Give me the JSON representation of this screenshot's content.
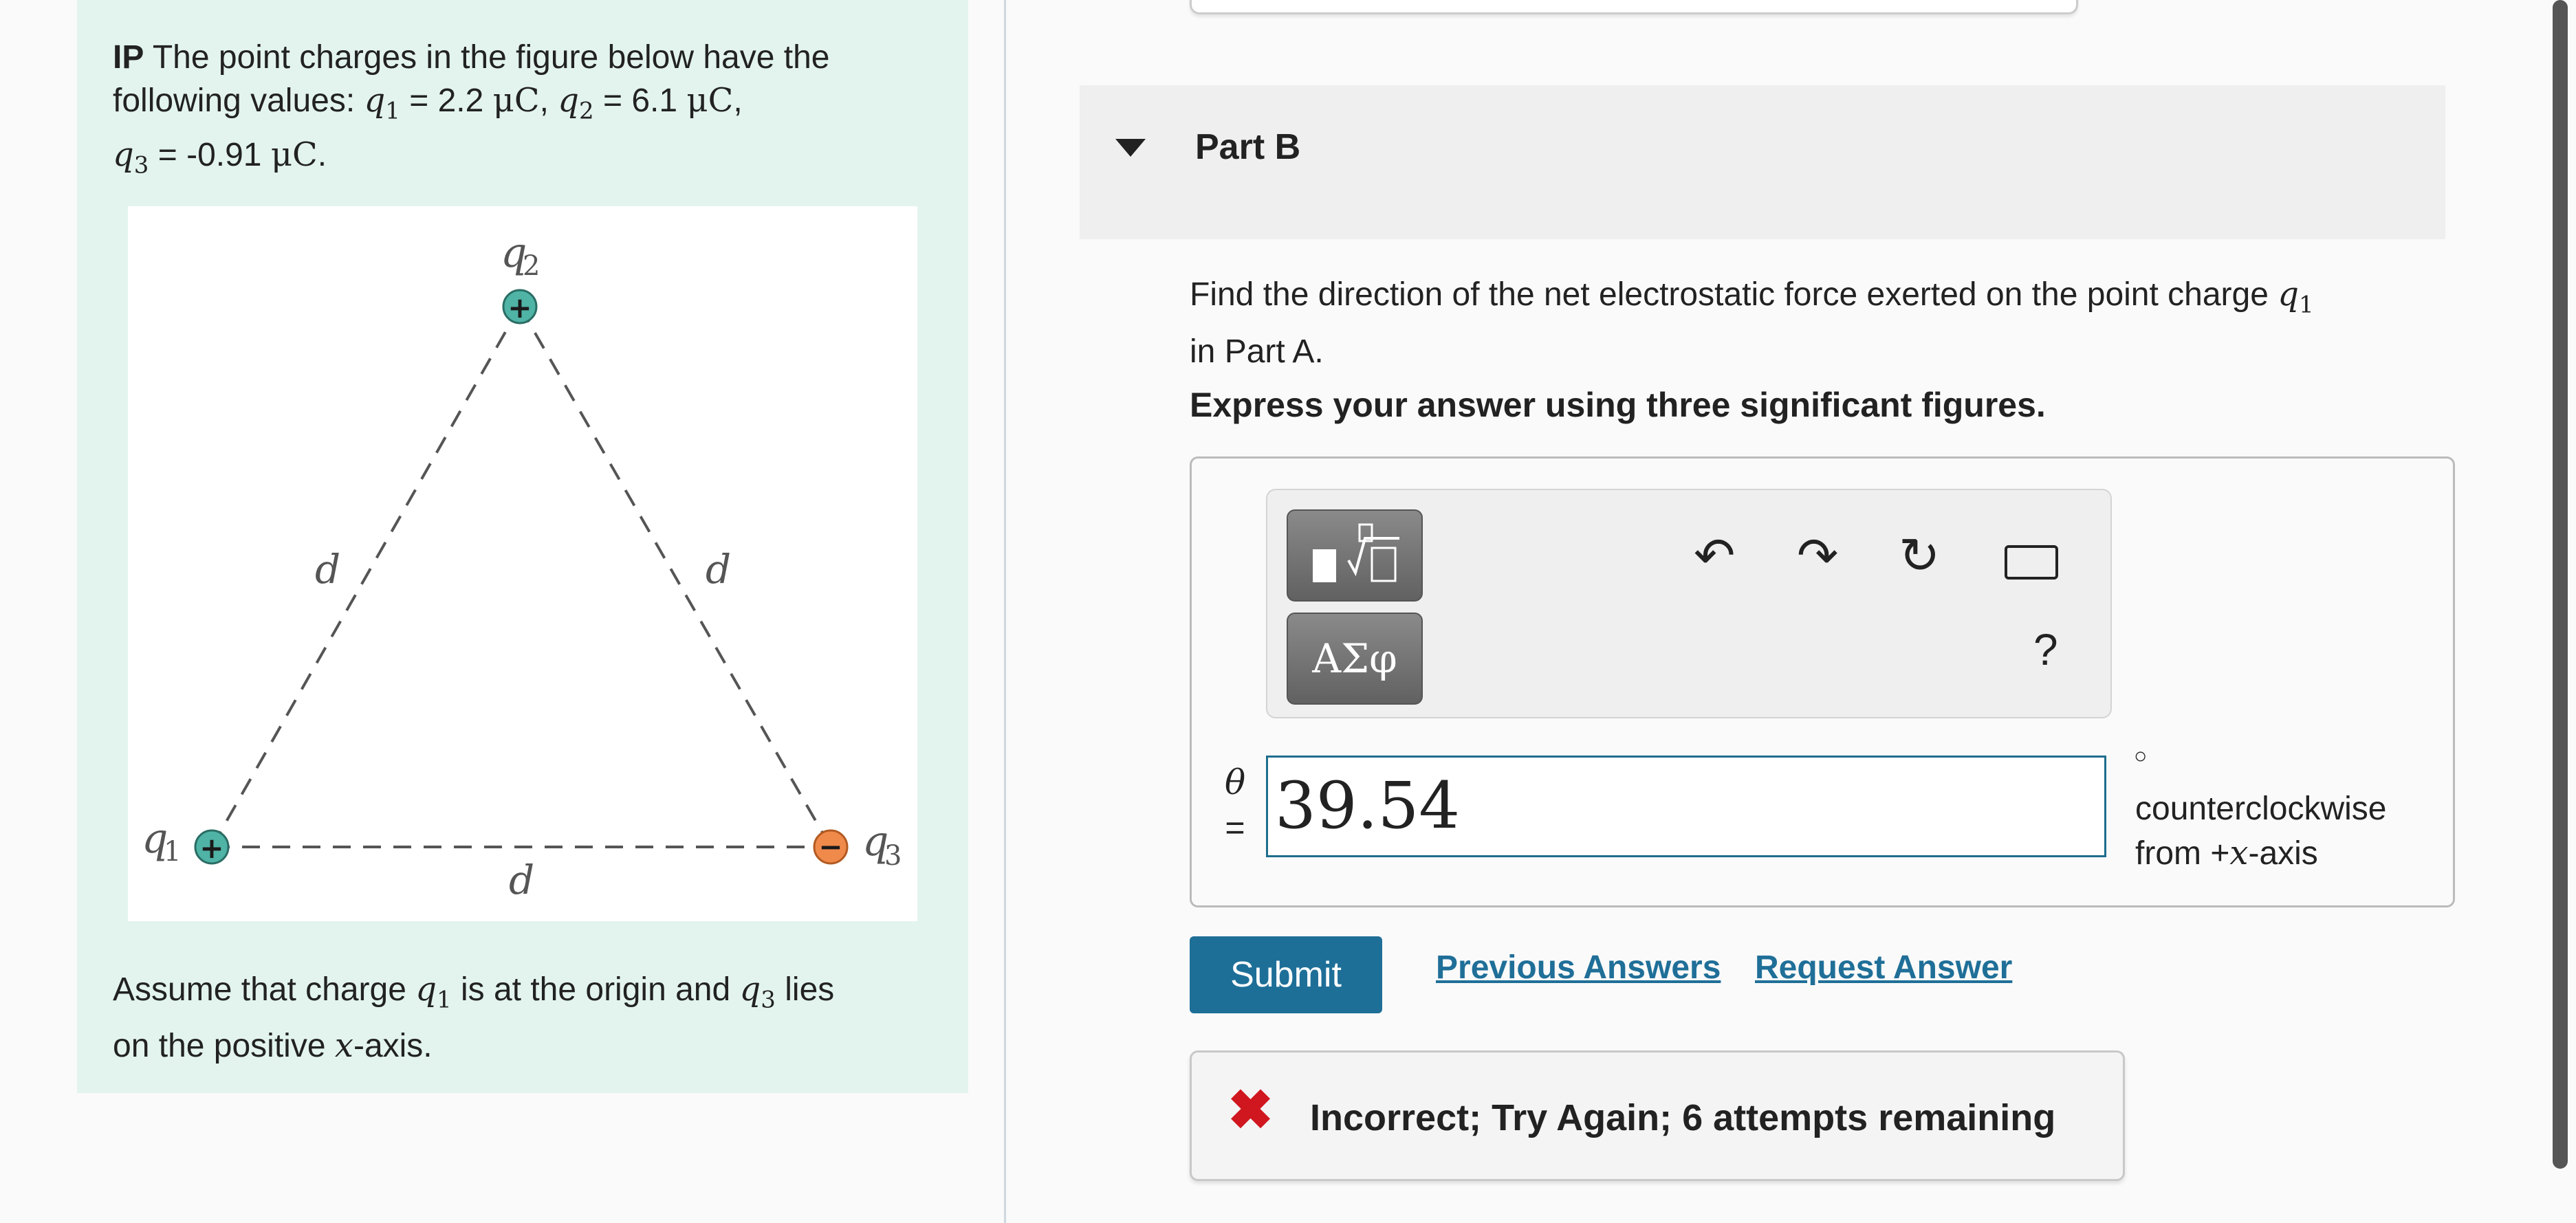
{
  "problem": {
    "intro_bold": "IP",
    "intro_line1": " The point charges in the figure below have the",
    "intro_line2_prefix": "following values: ",
    "q1_sym": "q",
    "q1_sub": "1",
    "q1_val": " = 2.2 ",
    "q2_sym": "q",
    "q2_sub": "2",
    "q2_val": " = 6.1 ",
    "q3_sym": "q",
    "q3_sub": "3",
    "q3_val": " = -0.91 ",
    "unit": "μC",
    "comma": ",",
    "period": ".",
    "assume_prefix": "Assume that charge ",
    "assume_mid": " is at the origin and ",
    "assume_suffix": " lies",
    "assume_line2a": "on the positive ",
    "assume_x": "x",
    "assume_line2b": "-axis."
  },
  "figure": {
    "label_q1": "q",
    "label_q1_sub": "1",
    "label_q2": "q",
    "label_q2_sub": "2",
    "label_q3": "q",
    "label_q3_sub": "3",
    "side_label": "d",
    "plus": "+",
    "minus": "−",
    "positive_color": "#4fb3a6",
    "negative_color": "#f08a4b"
  },
  "part": {
    "title": "Part B",
    "question_a": "Find the direction of the net electrostatic force exerted on the point charge ",
    "question_sym": "q",
    "question_sub": "1",
    "question_b": "in Part A.",
    "instruction": "Express your answer using three significant figures."
  },
  "toolbar": {
    "greek_label": "ΑΣφ",
    "undo_icon": "↶",
    "redo_icon": "↷",
    "reset_icon": "↻",
    "help_label": "?"
  },
  "answer": {
    "var_label": "θ",
    "equals": "=",
    "value": "39.54",
    "degree": "○",
    "unit_line1": "counterclockwise",
    "unit_line2a": "from +",
    "unit_line2x": "x",
    "unit_line2b": "-axis"
  },
  "actions": {
    "submit_label": "Submit",
    "previous_label": "Previous Answers",
    "request_label": "Request Answer"
  },
  "feedback": {
    "icon": "✖",
    "message": "Incorrect; Try Again; 6 attempts remaining"
  },
  "colors": {
    "accent": "#1e6f98",
    "error": "#d0161e",
    "panel_bg": "#e3f4ee"
  }
}
